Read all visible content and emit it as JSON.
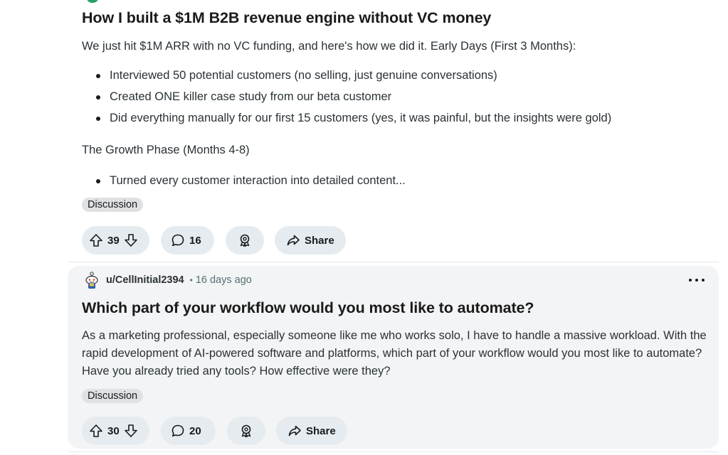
{
  "posts": [
    {
      "title": "How I built a $1M B2B revenue engine without VC money",
      "intro": "We just hit $1M ARR with no VC funding, and here's how we did it. Early Days (First 3 Months):",
      "bullets_1": [
        "Interviewed 50 potential customers (no selling, just genuine conversations)",
        "Created ONE killer case study from our beta customer",
        "Did everything manually for our first 15 customers (yes, it was painful, but the insights were gold)"
      ],
      "section_2": "The Growth Phase (Months 4-8)",
      "bullets_2": [
        "Turned every customer interaction into detailed content..."
      ],
      "flair": "Discussion",
      "votes": "39",
      "comments": "16",
      "share_label": "Share"
    },
    {
      "author": "u/CellInitial2394",
      "separator": "•",
      "time": "16 days ago",
      "title": "Which part of your workflow would you most like to automate?",
      "body": "As a marketing professional, especially someone like me who works solo, I have to handle a massive workload. With the rapid development of AI-powered software and platforms, which part of your workflow would you most like to automate? Have you already tried any tools? How effective were they?",
      "flair": "Discussion",
      "votes": "30",
      "comments": "20",
      "share_label": "Share"
    }
  ],
  "icons": {
    "upvote": "upvote-arrow-icon",
    "downvote": "downvote-arrow-icon",
    "comment": "comment-bubble-icon",
    "award": "award-icon",
    "share": "share-arrow-icon",
    "more": "more-options-icon"
  }
}
